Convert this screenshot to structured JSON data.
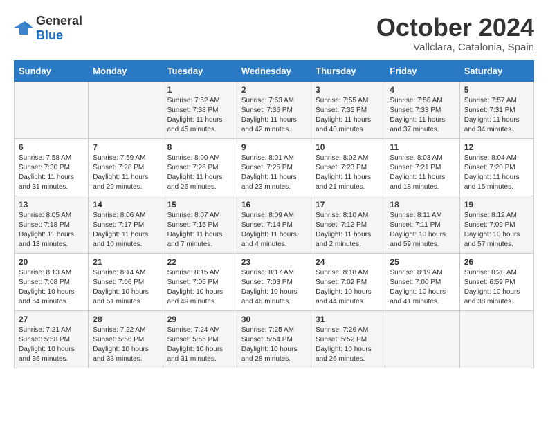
{
  "logo": {
    "general": "General",
    "blue": "Blue"
  },
  "title": "October 2024",
  "subtitle": "Vallclara, Catalonia, Spain",
  "days_of_week": [
    "Sunday",
    "Monday",
    "Tuesday",
    "Wednesday",
    "Thursday",
    "Friday",
    "Saturday"
  ],
  "weeks": [
    [
      {
        "day": "",
        "sunrise": "",
        "sunset": "",
        "daylight": ""
      },
      {
        "day": "",
        "sunrise": "",
        "sunset": "",
        "daylight": ""
      },
      {
        "day": "1",
        "sunrise": "Sunrise: 7:52 AM",
        "sunset": "Sunset: 7:38 PM",
        "daylight": "Daylight: 11 hours and 45 minutes."
      },
      {
        "day": "2",
        "sunrise": "Sunrise: 7:53 AM",
        "sunset": "Sunset: 7:36 PM",
        "daylight": "Daylight: 11 hours and 42 minutes."
      },
      {
        "day": "3",
        "sunrise": "Sunrise: 7:55 AM",
        "sunset": "Sunset: 7:35 PM",
        "daylight": "Daylight: 11 hours and 40 minutes."
      },
      {
        "day": "4",
        "sunrise": "Sunrise: 7:56 AM",
        "sunset": "Sunset: 7:33 PM",
        "daylight": "Daylight: 11 hours and 37 minutes."
      },
      {
        "day": "5",
        "sunrise": "Sunrise: 7:57 AM",
        "sunset": "Sunset: 7:31 PM",
        "daylight": "Daylight: 11 hours and 34 minutes."
      }
    ],
    [
      {
        "day": "6",
        "sunrise": "Sunrise: 7:58 AM",
        "sunset": "Sunset: 7:30 PM",
        "daylight": "Daylight: 11 hours and 31 minutes."
      },
      {
        "day": "7",
        "sunrise": "Sunrise: 7:59 AM",
        "sunset": "Sunset: 7:28 PM",
        "daylight": "Daylight: 11 hours and 29 minutes."
      },
      {
        "day": "8",
        "sunrise": "Sunrise: 8:00 AM",
        "sunset": "Sunset: 7:26 PM",
        "daylight": "Daylight: 11 hours and 26 minutes."
      },
      {
        "day": "9",
        "sunrise": "Sunrise: 8:01 AM",
        "sunset": "Sunset: 7:25 PM",
        "daylight": "Daylight: 11 hours and 23 minutes."
      },
      {
        "day": "10",
        "sunrise": "Sunrise: 8:02 AM",
        "sunset": "Sunset: 7:23 PM",
        "daylight": "Daylight: 11 hours and 21 minutes."
      },
      {
        "day": "11",
        "sunrise": "Sunrise: 8:03 AM",
        "sunset": "Sunset: 7:21 PM",
        "daylight": "Daylight: 11 hours and 18 minutes."
      },
      {
        "day": "12",
        "sunrise": "Sunrise: 8:04 AM",
        "sunset": "Sunset: 7:20 PM",
        "daylight": "Daylight: 11 hours and 15 minutes."
      }
    ],
    [
      {
        "day": "13",
        "sunrise": "Sunrise: 8:05 AM",
        "sunset": "Sunset: 7:18 PM",
        "daylight": "Daylight: 11 hours and 13 minutes."
      },
      {
        "day": "14",
        "sunrise": "Sunrise: 8:06 AM",
        "sunset": "Sunset: 7:17 PM",
        "daylight": "Daylight: 11 hours and 10 minutes."
      },
      {
        "day": "15",
        "sunrise": "Sunrise: 8:07 AM",
        "sunset": "Sunset: 7:15 PM",
        "daylight": "Daylight: 11 hours and 7 minutes."
      },
      {
        "day": "16",
        "sunrise": "Sunrise: 8:09 AM",
        "sunset": "Sunset: 7:14 PM",
        "daylight": "Daylight: 11 hours and 4 minutes."
      },
      {
        "day": "17",
        "sunrise": "Sunrise: 8:10 AM",
        "sunset": "Sunset: 7:12 PM",
        "daylight": "Daylight: 11 hours and 2 minutes."
      },
      {
        "day": "18",
        "sunrise": "Sunrise: 8:11 AM",
        "sunset": "Sunset: 7:11 PM",
        "daylight": "Daylight: 10 hours and 59 minutes."
      },
      {
        "day": "19",
        "sunrise": "Sunrise: 8:12 AM",
        "sunset": "Sunset: 7:09 PM",
        "daylight": "Daylight: 10 hours and 57 minutes."
      }
    ],
    [
      {
        "day": "20",
        "sunrise": "Sunrise: 8:13 AM",
        "sunset": "Sunset: 7:08 PM",
        "daylight": "Daylight: 10 hours and 54 minutes."
      },
      {
        "day": "21",
        "sunrise": "Sunrise: 8:14 AM",
        "sunset": "Sunset: 7:06 PM",
        "daylight": "Daylight: 10 hours and 51 minutes."
      },
      {
        "day": "22",
        "sunrise": "Sunrise: 8:15 AM",
        "sunset": "Sunset: 7:05 PM",
        "daylight": "Daylight: 10 hours and 49 minutes."
      },
      {
        "day": "23",
        "sunrise": "Sunrise: 8:17 AM",
        "sunset": "Sunset: 7:03 PM",
        "daylight": "Daylight: 10 hours and 46 minutes."
      },
      {
        "day": "24",
        "sunrise": "Sunrise: 8:18 AM",
        "sunset": "Sunset: 7:02 PM",
        "daylight": "Daylight: 10 hours and 44 minutes."
      },
      {
        "day": "25",
        "sunrise": "Sunrise: 8:19 AM",
        "sunset": "Sunset: 7:00 PM",
        "daylight": "Daylight: 10 hours and 41 minutes."
      },
      {
        "day": "26",
        "sunrise": "Sunrise: 8:20 AM",
        "sunset": "Sunset: 6:59 PM",
        "daylight": "Daylight: 10 hours and 38 minutes."
      }
    ],
    [
      {
        "day": "27",
        "sunrise": "Sunrise: 7:21 AM",
        "sunset": "Sunset: 5:58 PM",
        "daylight": "Daylight: 10 hours and 36 minutes."
      },
      {
        "day": "28",
        "sunrise": "Sunrise: 7:22 AM",
        "sunset": "Sunset: 5:56 PM",
        "daylight": "Daylight: 10 hours and 33 minutes."
      },
      {
        "day": "29",
        "sunrise": "Sunrise: 7:24 AM",
        "sunset": "Sunset: 5:55 PM",
        "daylight": "Daylight: 10 hours and 31 minutes."
      },
      {
        "day": "30",
        "sunrise": "Sunrise: 7:25 AM",
        "sunset": "Sunset: 5:54 PM",
        "daylight": "Daylight: 10 hours and 28 minutes."
      },
      {
        "day": "31",
        "sunrise": "Sunrise: 7:26 AM",
        "sunset": "Sunset: 5:52 PM",
        "daylight": "Daylight: 10 hours and 26 minutes."
      },
      {
        "day": "",
        "sunrise": "",
        "sunset": "",
        "daylight": ""
      },
      {
        "day": "",
        "sunrise": "",
        "sunset": "",
        "daylight": ""
      }
    ]
  ]
}
